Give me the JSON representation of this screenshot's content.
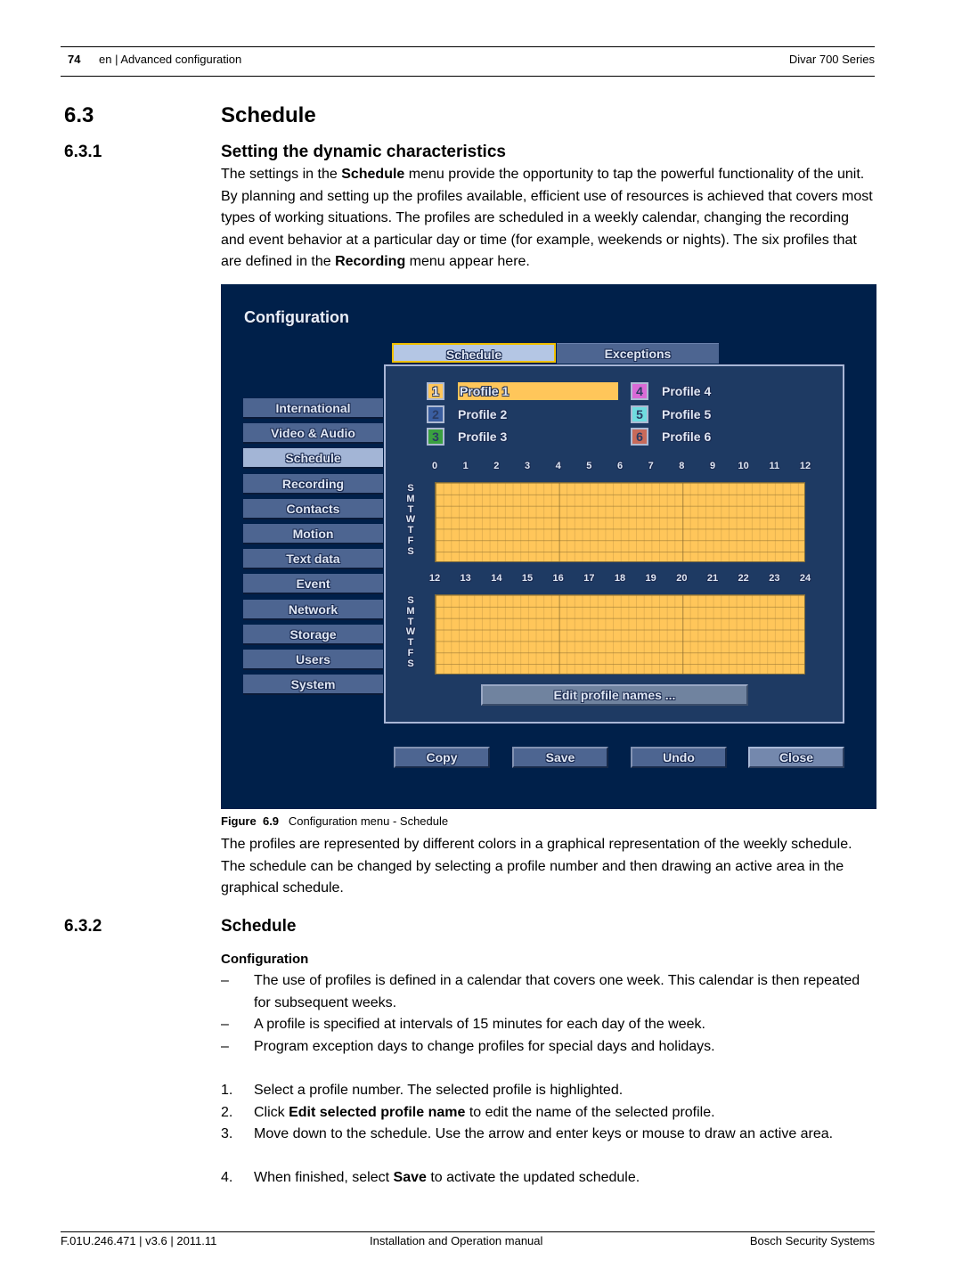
{
  "header": {
    "page_number": "74",
    "section": "en | Advanced configuration",
    "product": "Divar 700 Series"
  },
  "section": {
    "number": "6.3",
    "title": "Schedule"
  },
  "subsection1": {
    "number": "6.3.1",
    "title": "Setting the dynamic characteristics",
    "paragraph": [
      {
        "text": "The settings in the ",
        "bold": false
      },
      {
        "text": "Schedule",
        "bold": true
      },
      {
        "text": " menu provide the opportunity to tap the powerful functionality of the unit. By planning and setting up the profiles available, efficient use of resources is achieved that covers most types of working situations. The profiles are scheduled in a weekly calendar, changing the recording and event behavior at a particular day or time (for example, weekends or nights). The six profiles that are defined in the ",
        "bold": false
      },
      {
        "text": "Recording",
        "bold": true
      },
      {
        "text": " menu appear here.",
        "bold": false
      }
    ]
  },
  "screenshot": {
    "title": "Configuration",
    "tabs": [
      {
        "label": "Schedule",
        "active": true
      },
      {
        "label": "Exceptions",
        "active": false
      }
    ],
    "sidebar": [
      {
        "label": "International",
        "active": false
      },
      {
        "label": "Video & Audio",
        "active": false
      },
      {
        "label": "Schedule",
        "active": true
      },
      {
        "label": "Recording",
        "active": false
      },
      {
        "label": "Contacts",
        "active": false
      },
      {
        "label": "Motion",
        "active": false
      },
      {
        "label": "Text data",
        "active": false
      },
      {
        "label": "Event",
        "active": false
      },
      {
        "label": "Network",
        "active": false
      },
      {
        "label": "Storage",
        "active": false
      },
      {
        "label": "Users",
        "active": false
      },
      {
        "label": "System",
        "active": false
      }
    ],
    "profiles": [
      {
        "number": "1",
        "name": "Profile 1",
        "color": "#ffc65a",
        "selected": true
      },
      {
        "number": "2",
        "name": "Profile 2",
        "color": "#3a5ea0",
        "selected": false
      },
      {
        "number": "3",
        "name": "Profile 3",
        "color": "#3aa040",
        "selected": false
      },
      {
        "number": "4",
        "name": "Profile 4",
        "color": "#d96ad6",
        "selected": false
      },
      {
        "number": "5",
        "name": "Profile 5",
        "color": "#6fdce0",
        "selected": false
      },
      {
        "number": "6",
        "name": "Profile 6",
        "color": "#c86a5a",
        "selected": false
      }
    ],
    "hours_am": [
      "0",
      "1",
      "2",
      "3",
      "4",
      "5",
      "6",
      "7",
      "8",
      "9",
      "10",
      "11",
      "12"
    ],
    "hours_pm": [
      "12",
      "13",
      "14",
      "15",
      "16",
      "17",
      "18",
      "19",
      "20",
      "21",
      "22",
      "23",
      "24"
    ],
    "days": [
      "S",
      "M",
      "T",
      "W",
      "T",
      "F",
      "S"
    ],
    "schedule_fill_profile": "1",
    "edit_button": "Edit profile names ...",
    "buttons": {
      "copy": "Copy",
      "save": "Save",
      "undo": "Undo",
      "close": "Close"
    }
  },
  "figure": {
    "label": "Figure",
    "number": "6.9",
    "caption": "Configuration menu - Schedule"
  },
  "paragraph2": "The profiles are represented by different colors in a graphical representation of the weekly schedule. The schedule can be changed by selecting a profile number and then drawing an active area in the graphical schedule.",
  "subsection2": {
    "number": "6.3.2",
    "title": "Schedule",
    "subheading": "Configuration",
    "bullets": [
      "The use of profiles is defined in a calendar that covers one week. This calendar is then repeated for subsequent weeks.",
      "A profile is specified at intervals of 15 minutes for each day of the week.",
      "Program exception days to change profiles for special days and holidays."
    ],
    "bullet_mark": "–",
    "steps": [
      {
        "num": "1.",
        "parts": [
          {
            "text": "Select a profile number. The selected profile is highlighted.",
            "bold": false
          }
        ]
      },
      {
        "num": "2.",
        "parts": [
          {
            "text": "Click ",
            "bold": false
          },
          {
            "text": "Edit selected profile name",
            "bold": true
          },
          {
            "text": " to edit the name of the selected profile.",
            "bold": false
          }
        ]
      },
      {
        "num": "3.",
        "parts": [
          {
            "text": "Move down to the schedule. Use the arrow and enter keys or mouse to draw an active area.",
            "bold": false
          }
        ]
      },
      {
        "num": "4.",
        "parts": [
          {
            "text": "When finished, select ",
            "bold": false
          },
          {
            "text": "Save",
            "bold": true
          },
          {
            "text": " to activate the updated schedule.",
            "bold": false
          }
        ]
      }
    ]
  },
  "footer": {
    "doc_id": "F.01U.246.471 | v3.6 | 2011.11",
    "doc_type": "Installation and Operation manual",
    "company": "Bosch Security Systems"
  }
}
